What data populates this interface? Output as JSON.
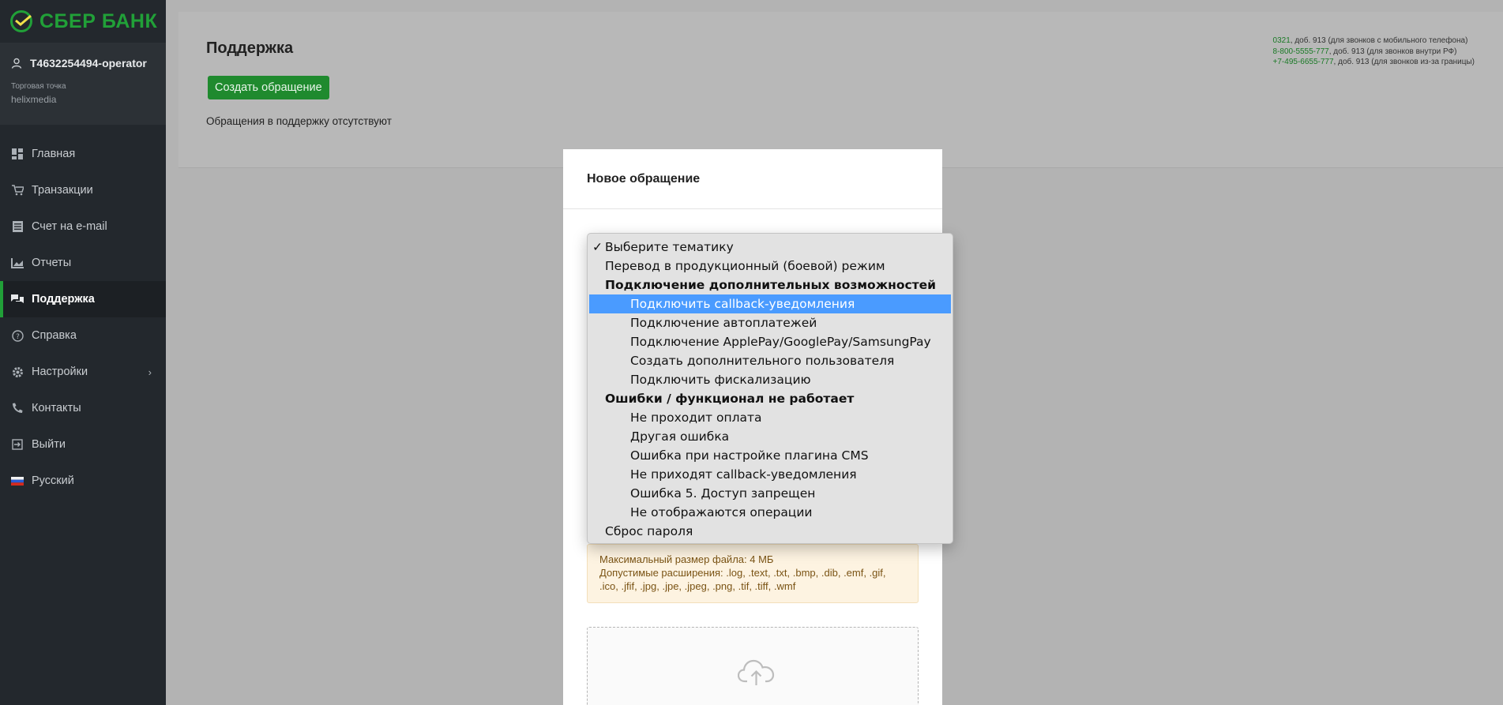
{
  "sidebar": {
    "brand": "СБЕР БАНК",
    "user": "T4632254494-operator",
    "outlet_label": "Торговая точка",
    "outlet_value": "helixmedia",
    "items": [
      {
        "label": "Главная",
        "icon": "dashboard-icon"
      },
      {
        "label": "Транзакции",
        "icon": "cart-icon"
      },
      {
        "label": "Счет на e-mail",
        "icon": "invoice-icon"
      },
      {
        "label": "Отчеты",
        "icon": "chart-icon"
      },
      {
        "label": "Поддержка",
        "icon": "support-icon",
        "active": true
      },
      {
        "label": "Справка",
        "icon": "help-icon"
      },
      {
        "label": "Настройки",
        "icon": "gear-icon",
        "has_arrow": true
      },
      {
        "label": "Контакты",
        "icon": "phone-icon"
      },
      {
        "label": "Выйти",
        "icon": "logout-icon"
      },
      {
        "label": "Русский",
        "icon": "russian-flag-icon"
      }
    ]
  },
  "main": {
    "title": "Поддержка",
    "create_button": "Создать обращение",
    "empty_note": "Обращения в поддержку отсутствуют",
    "contacts": [
      {
        "number": "0321",
        "text": ", доб. 913 (для звонков с мобильного телефона)"
      },
      {
        "number": "8-800-5555-777",
        "text": ", доб. 913 (для звонков внутри РФ)"
      },
      {
        "number": "+7-495-6655-777",
        "text": ", доб. 913 (для звонков из-за границы)"
      }
    ]
  },
  "modal": {
    "title": "Новое обращение",
    "notice_line1": "Максимальный размер файла: 4 МБ",
    "notice_line2": "Допустимые расширения: .log, .text, .txt, .bmp, .dib, .emf, .gif, .ico, .jfif, .jpg, .jpe, .jpeg, .png, .tif, .tiff, .wmf"
  },
  "dropdown": {
    "selected_index": 3,
    "options": [
      {
        "label": "Выберите тематику",
        "kind": "top",
        "checked": true
      },
      {
        "label": "Перевод в продукционный (боевой) режим",
        "kind": "top"
      },
      {
        "label": "Подключение дополнительных возможностей",
        "kind": "group"
      },
      {
        "label": "Подключить callback-уведомления",
        "kind": "sub",
        "highlighted": true
      },
      {
        "label": "Подключение автоплатежей",
        "kind": "sub"
      },
      {
        "label": "Подключение ApplePay/GooglePay/SamsungPay",
        "kind": "sub"
      },
      {
        "label": "Создать дополнительного пользователя",
        "kind": "sub"
      },
      {
        "label": "Подключить фискализацию",
        "kind": "sub"
      },
      {
        "label": "Ошибки / функционал не работает",
        "kind": "group"
      },
      {
        "label": "Не проходит оплата",
        "kind": "sub"
      },
      {
        "label": "Другая ошибка",
        "kind": "sub"
      },
      {
        "label": "Ошибка при настройке плагина CMS",
        "kind": "sub"
      },
      {
        "label": "Не приходят callback-уведомления",
        "kind": "sub"
      },
      {
        "label": "Ошибка 5. Доступ запрещен",
        "kind": "sub"
      },
      {
        "label": "Не отображаются операции",
        "kind": "sub"
      },
      {
        "label": "Сброс пароля",
        "kind": "top"
      }
    ]
  },
  "colors": {
    "brand_green": "#21a038",
    "highlight": "#4a9bff",
    "sidebar_bg": "#23282d"
  }
}
